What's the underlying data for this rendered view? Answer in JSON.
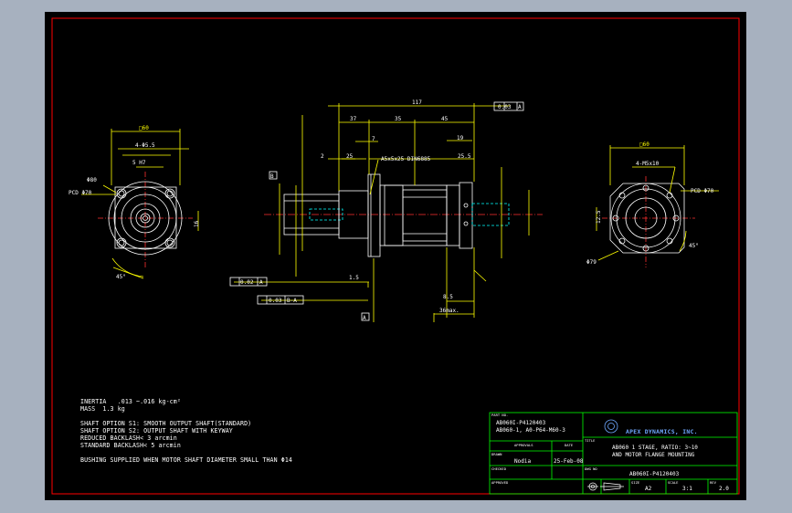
{
  "notes": [
    "INERTIA   .013 ~.016 kg-cm²",
    "MASS  1.3 kg",
    "SHAFT OPTION S1: SMOOTH OUTPUT SHAFT(STANDARD)",
    "SHAFT OPTION S2: OUTPUT SHAFT WITH KEYWAY",
    "REDUCED BACKLASH< 3 arcmin",
    "STANDARD BACKLASH< 5 arcmin",
    "BUSHING SUPPLIED WHEN MOTOR SHAFT DIAMETER SMALL THAN Φ14"
  ],
  "title_block": {
    "part_no_label": "PART NO.",
    "part_no_lines": [
      "AB060I-P4120403",
      "AB060-1, A0-P64-M60-3"
    ],
    "approval_label": "APPROVALS",
    "date_label": "DATE",
    "title_label": "TITLE",
    "company": "APEX DYNAMICS, INC.",
    "title_lines": [
      "AB060 1 STAGE, RATIO: 3~10",
      "AND MOTOR FLANGE MOUNTING"
    ],
    "drawn_label": "DRAWN",
    "drawn_by": "Nodia",
    "drawn_date": "25-Feb-08",
    "dwg_no_label": "DWG NO",
    "dwg_no": "AB060I-P4120403",
    "checked_label": "CHECKED",
    "approved_label": "APPROVED",
    "size_label": "SIZE",
    "size": "A2",
    "scale_label": "SCALE",
    "scale": "3:1",
    "rev_label": "REV",
    "rev": "2.0"
  },
  "dimensions": {
    "overall_length": "117",
    "len_37": "37",
    "len_35": "35",
    "len_45": "45",
    "len_7": "7",
    "len_2": "2",
    "len_25": "25",
    "len_19": "19",
    "len_25_5": "25.5",
    "key": "A5x5x25 DIN6885",
    "flatness": "0.03",
    "datum_a": "A",
    "datum_b": "B",
    "perp": "0.02",
    "runout": "0.03",
    "runout_ref": "B-A",
    "len_1_5": "1.5",
    "len_8_5": "8.5",
    "len_36max": "36max.",
    "sq_left": "□60",
    "sq_right": "□60",
    "holes_left": "4-Φ5.5",
    "thread_left": "5 H7",
    "pcd_left": "PCD Φ70",
    "dia_80": "Φ80",
    "dia_16": "16",
    "angle_45": "45°",
    "holes_right": "4-M5x10",
    "pcd_right": "PCD Φ70",
    "dia_79": "Φ79",
    "dia_12_5": "12.5"
  }
}
